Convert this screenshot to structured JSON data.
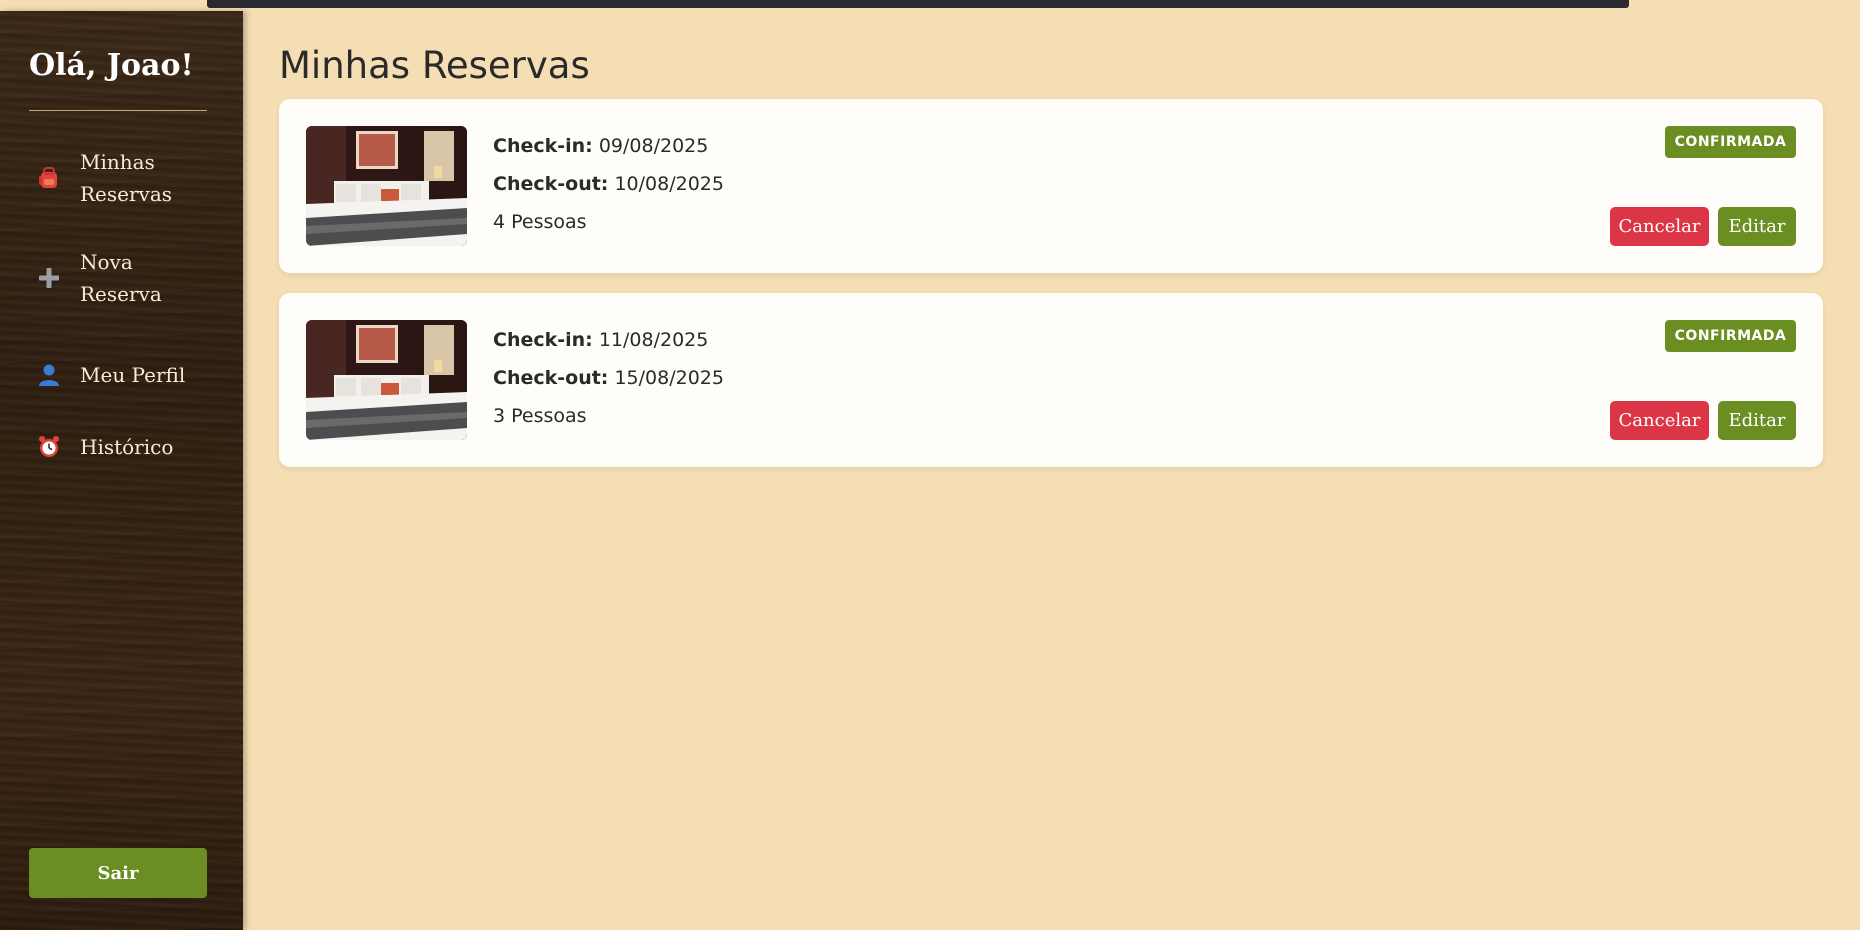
{
  "sidebar": {
    "greeting": "Olá, Joao!",
    "items": [
      {
        "label": "Minhas Reservas",
        "icon": "backpack-icon"
      },
      {
        "label": "Nova Reserva",
        "icon": "plus-icon"
      },
      {
        "label": "Meu Perfil",
        "icon": "user-icon"
      },
      {
        "label": "Histórico",
        "icon": "alarm-clock-icon"
      }
    ],
    "logout_label": "Sair"
  },
  "main": {
    "title": "Minhas Reservas",
    "checkin_label": "Check-in:",
    "checkout_label": "Check-out:",
    "reservations": [
      {
        "checkin": "09/08/2025",
        "checkout": "10/08/2025",
        "guests": "4 Pessoas",
        "status": "CONFIRMADA",
        "cancel_label": "Cancelar",
        "edit_label": "Editar"
      },
      {
        "checkin": "11/08/2025",
        "checkout": "15/08/2025",
        "guests": "3 Pessoas",
        "status": "CONFIRMADA",
        "cancel_label": "Cancelar",
        "edit_label": "Editar"
      }
    ]
  },
  "colors": {
    "background": "#f5deb3",
    "accent_green": "#6b8e23",
    "danger_red": "#dc3545"
  }
}
